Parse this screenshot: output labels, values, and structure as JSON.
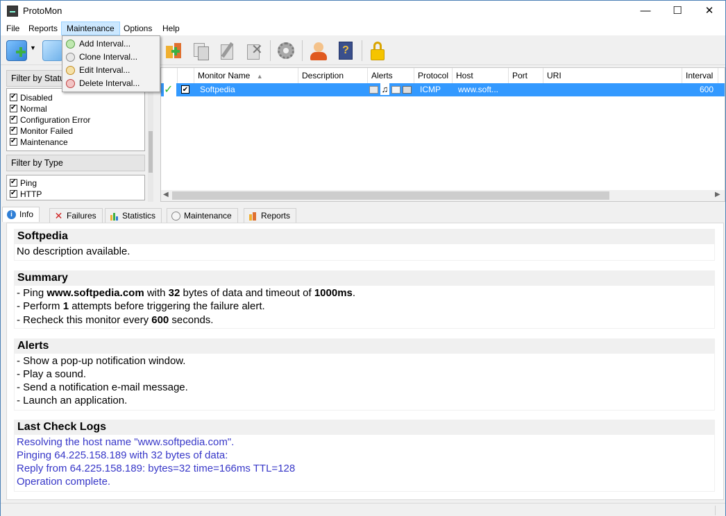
{
  "window": {
    "title": "ProtoMon",
    "minimize": "—",
    "maximize": "☐",
    "close": "✕"
  },
  "menu": [
    "File",
    "Reports",
    "Maintenance",
    "Options",
    "Help"
  ],
  "maintenance_menu": [
    "Add Interval...",
    "Clone Interval...",
    "Edit Interval...",
    "Delete Interval..."
  ],
  "filters": {
    "status_title": "Filter by Status",
    "status_items": [
      "Disabled",
      "Normal",
      "Configuration Error",
      "Monitor Failed",
      "Maintenance"
    ],
    "type_title": "Filter by Type",
    "type_items": [
      "Ping",
      "HTTP"
    ]
  },
  "grid": {
    "columns": [
      "Monitor Name",
      "Description",
      "Alerts",
      "Protocol",
      "Host",
      "Port",
      "URI",
      "Interval"
    ],
    "sort_indicator": "▲",
    "row": {
      "name": "Softpedia",
      "description": "",
      "protocol": "ICMP",
      "host": "www.soft...",
      "port": "",
      "uri": "",
      "interval": "600",
      "status_mark": "✓",
      "checkbox_mark": "✔"
    }
  },
  "tabs": [
    "Info",
    "Failures",
    "Statistics",
    "Maintenance",
    "Reports"
  ],
  "info": {
    "name": "Softpedia",
    "description": "No description available.",
    "summary_title": "Summary",
    "summary": {
      "ping_prefix": "- Ping ",
      "host": "www.softpedia.com",
      "with": " with ",
      "bytes": "32",
      "bytes_suffix": " bytes of data and timeout of ",
      "timeout": "1000ms",
      "period": ".",
      "perform_prefix": "- Perform ",
      "attempts": "1",
      "perform_suffix": " attempts before triggering the failure alert.",
      "recheck_prefix": "- Recheck this monitor every ",
      "seconds": "600",
      "recheck_suffix": " seconds."
    },
    "alerts_title": "Alerts",
    "alerts": [
      "- Show a pop-up notification window.",
      "- Play a sound.",
      "- Send a notification e-mail message.",
      "- Launch an application."
    ],
    "logs_title": "Last Check Logs",
    "logs": [
      "Resolving the host name \"www.softpedia.com\".",
      "Pinging 64.225.158.189 with 32 bytes of data:",
      "Reply from 64.225.158.189: bytes=32 time=166ms TTL=128",
      "Operation complete."
    ]
  },
  "colors": {
    "selection": "#3399ff",
    "log_text": "#3737c8",
    "menu_highlight": "#cce8ff"
  },
  "icons": [
    "add-monitor-icon",
    "dropdown-arrow-icon",
    "monitor-icon",
    "category-add-icon",
    "copy-icon",
    "edit-icon",
    "delete-icon",
    "gear-icon",
    "support-icon",
    "help-book-icon",
    "lock-icon"
  ]
}
